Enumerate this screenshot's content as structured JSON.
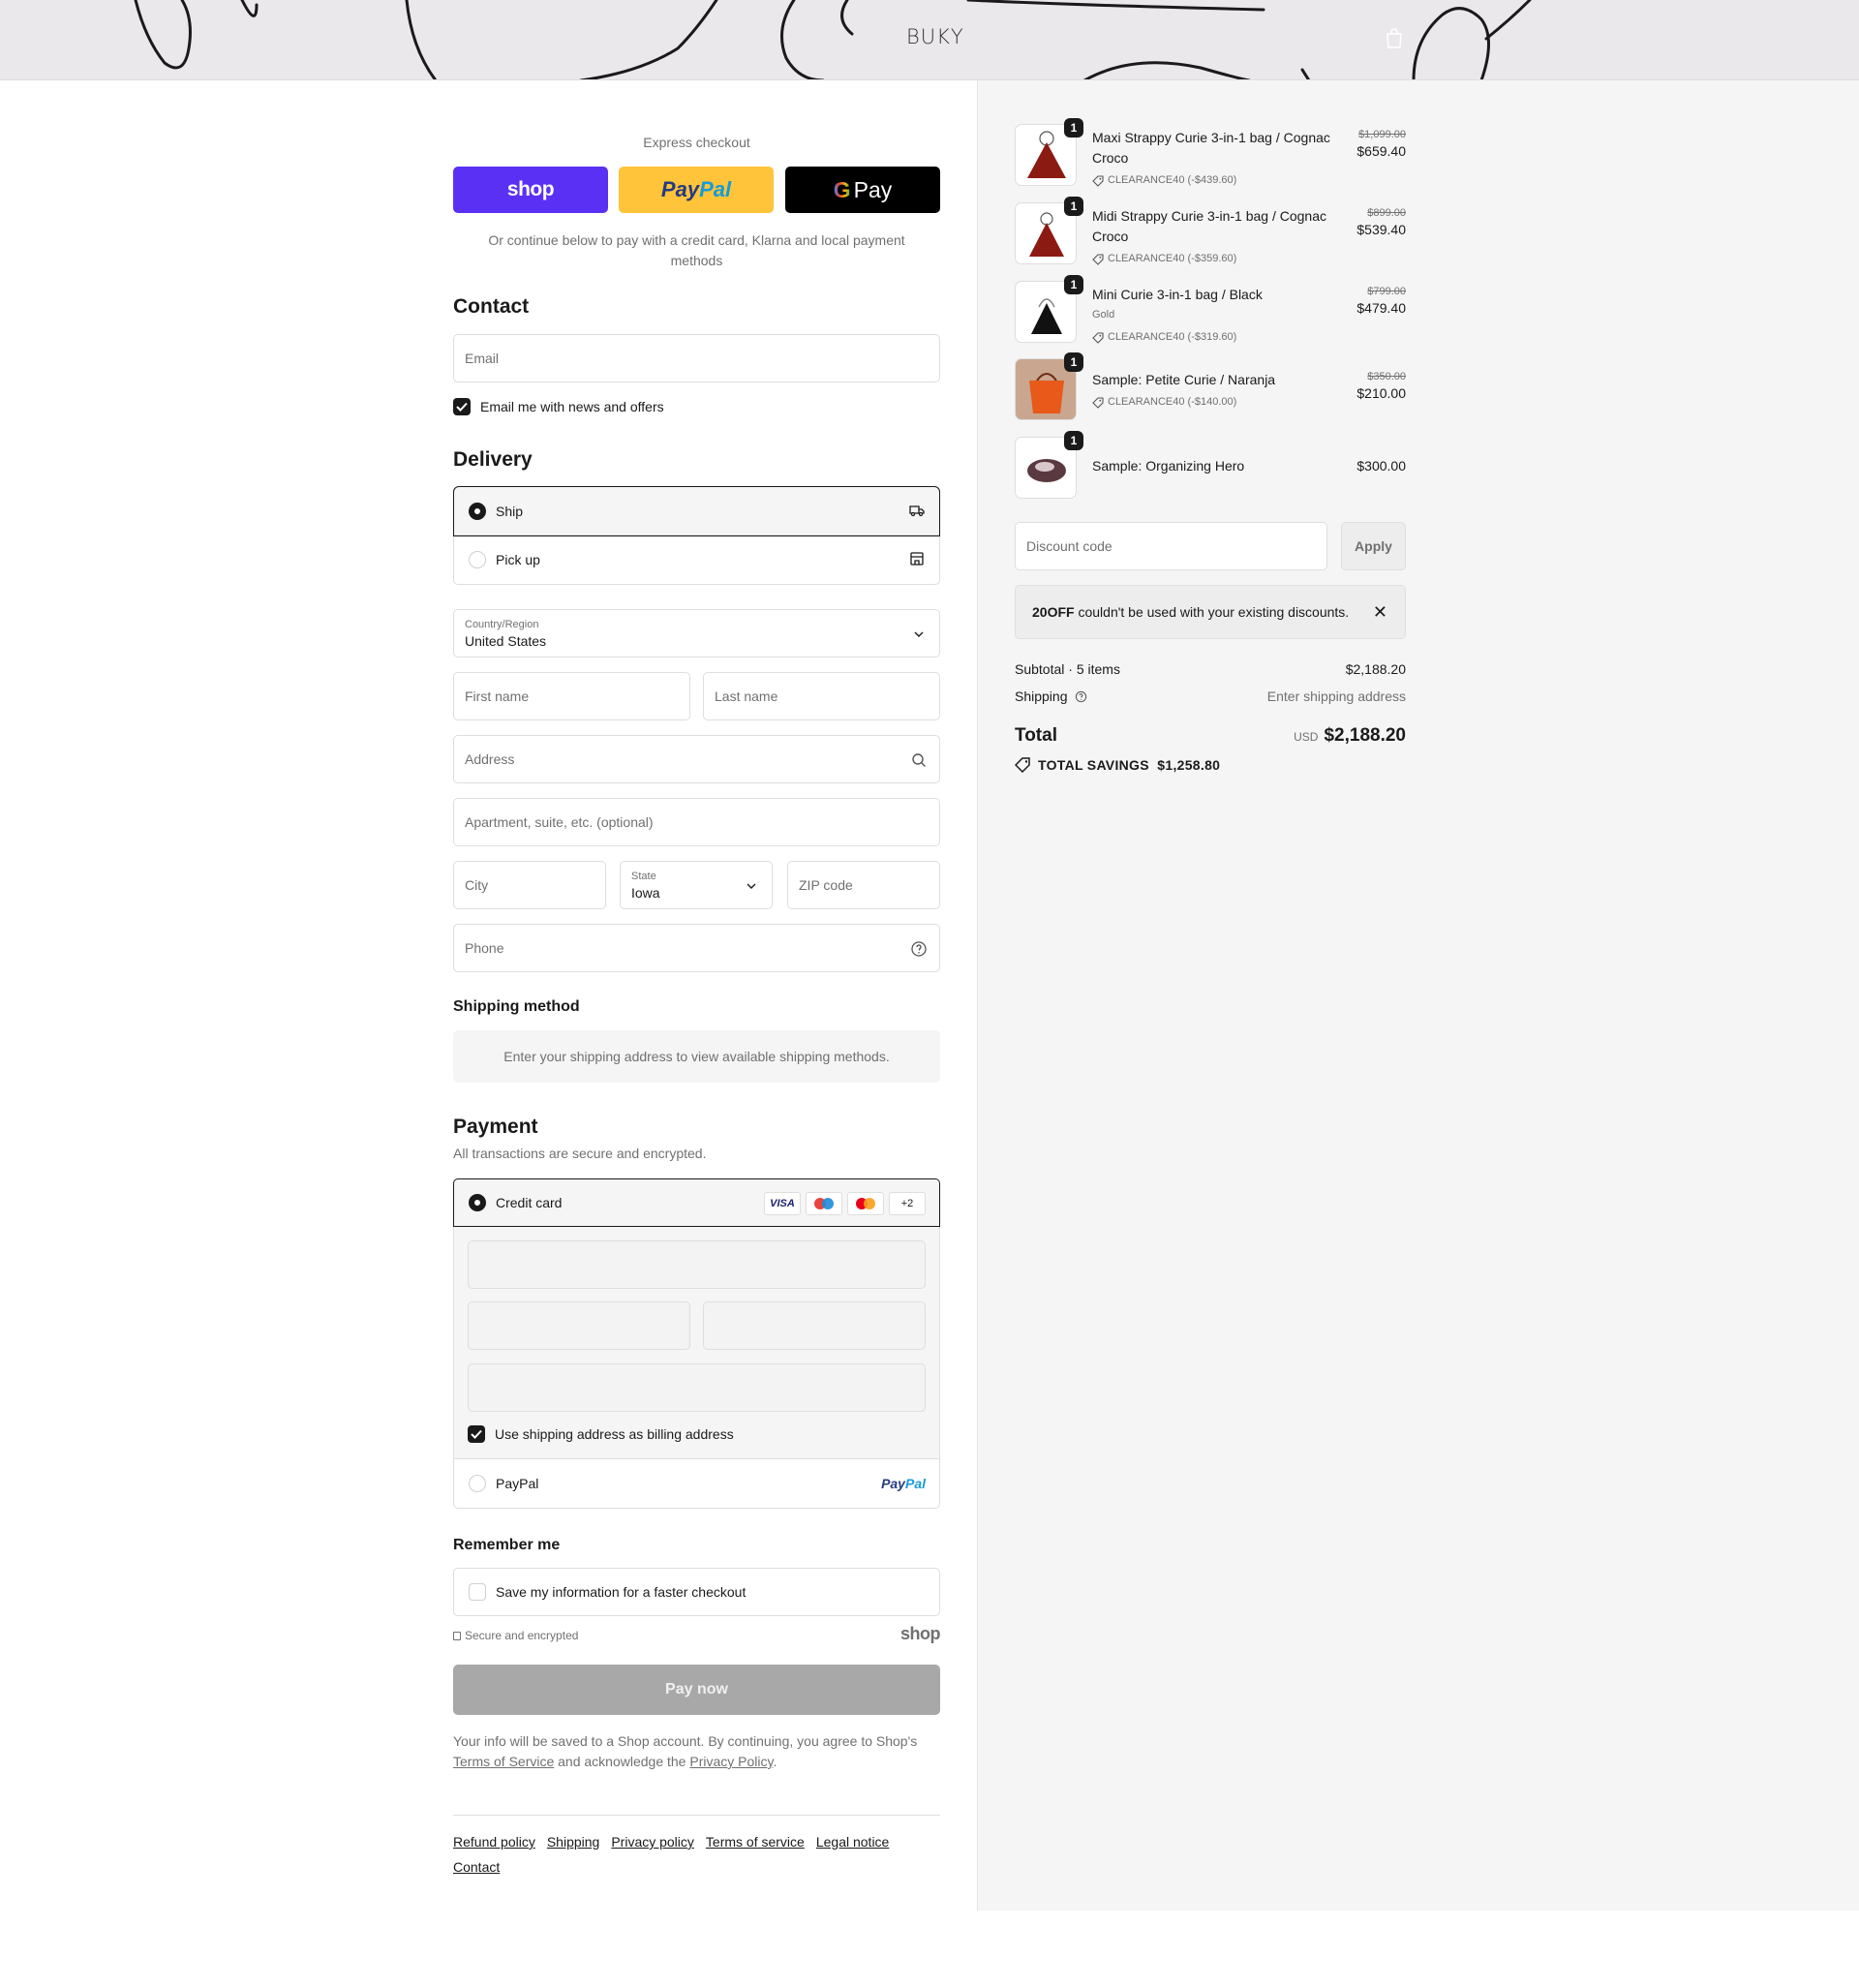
{
  "header": {
    "logo": "BUKY",
    "cart_icon": "shopping-bag-icon"
  },
  "express": {
    "label": "Express checkout",
    "shop_label": "shop",
    "paypal_label_1": "Pay",
    "paypal_label_2": "Pal",
    "gpay_label": "Pay",
    "continue_text": "Or continue below to pay with a credit card, Klarna and local payment methods"
  },
  "contact": {
    "title": "Contact",
    "email_placeholder": "Email",
    "news_label": "Email me with news and offers",
    "news_checked": true
  },
  "delivery": {
    "title": "Delivery",
    "options": [
      {
        "label": "Ship",
        "selected": true,
        "icon": "truck-icon"
      },
      {
        "label": "Pick up",
        "selected": false,
        "icon": "store-icon"
      }
    ],
    "country_label": "Country/Region",
    "country_value": "United States",
    "first_name_placeholder": "First name",
    "last_name_placeholder": "Last name",
    "address_placeholder": "Address",
    "apartment_placeholder": "Apartment, suite, etc. (optional)",
    "city_placeholder": "City",
    "state_label": "State",
    "state_value": "Iowa",
    "zip_placeholder": "ZIP code",
    "phone_placeholder": "Phone"
  },
  "shipping_method": {
    "title": "Shipping method",
    "message": "Enter your shipping address to view available shipping methods."
  },
  "payment": {
    "title": "Payment",
    "subtitle": "All transactions are secure and encrypted.",
    "credit_card_label": "Credit card",
    "card_logos": [
      "VISA",
      "maestro",
      "mastercard",
      "+2"
    ],
    "billing_label": "Use shipping address as billing address",
    "billing_checked": true,
    "paypal_label": "PayPal",
    "paypal_mark_1": "Pay",
    "paypal_mark_2": "Pal"
  },
  "remember": {
    "title": "Remember me",
    "save_label": "Save my information for a faster checkout",
    "secure_label": "Secure and encrypted",
    "shop_mark": "shop"
  },
  "pay_now": "Pay now",
  "legal": {
    "text_1": "Your info will be saved to a Shop account. By continuing, you agree to Shop's",
    "tos": "Terms of Service",
    "text_2": "and acknowledge the",
    "privacy": "Privacy Policy",
    "text_3": "."
  },
  "footer": {
    "links": [
      "Refund policy",
      "Shipping",
      "Privacy policy",
      "Terms of service",
      "Legal notice",
      "Contact"
    ]
  },
  "summary": {
    "items": [
      {
        "qty": "1",
        "name": "Maxi Strappy Curie 3-in-1 bag / Cognac Croco",
        "variant": "",
        "discount": "CLEARANCE40 (-$439.60)",
        "old_price": "$1,099.00",
        "price": "$659.40",
        "color": "#8b1a12"
      },
      {
        "qty": "1",
        "name": "Midi Strappy Curie 3-in-1 bag / Cognac Croco",
        "variant": "",
        "discount": "CLEARANCE40 (-$359.60)",
        "old_price": "$899.00",
        "price": "$539.40",
        "color": "#8b1a12"
      },
      {
        "qty": "1",
        "name": "Mini Curie 3-in-1 bag / Black",
        "variant": "Gold",
        "discount": "CLEARANCE40 (-$319.60)",
        "old_price": "$799.00",
        "price": "$479.40",
        "color": "#111111"
      },
      {
        "qty": "1",
        "name": "Sample: Petite Curie / Naranja",
        "variant": "",
        "discount": "CLEARANCE40 (-$140.00)",
        "old_price": "$350.00",
        "price": "$210.00",
        "color": "#e8591a"
      },
      {
        "qty": "1",
        "name": "Sample: Organizing Hero",
        "variant": "",
        "discount": "",
        "old_price": "",
        "price": "$300.00",
        "color": "#5a3a40"
      }
    ],
    "discount_placeholder": "Discount code",
    "apply_label": "Apply",
    "warning_code": "20OFF",
    "warning_text": "couldn't be used with your existing discounts.",
    "subtotal_label": "Subtotal · 5 items",
    "subtotal_value": "$2,188.20",
    "shipping_label": "Shipping",
    "shipping_value": "Enter shipping address",
    "total_label": "Total",
    "currency": "USD",
    "total_value": "$2,188.20",
    "savings_label": "TOTAL SAVINGS",
    "savings_value": "$1,258.80"
  }
}
